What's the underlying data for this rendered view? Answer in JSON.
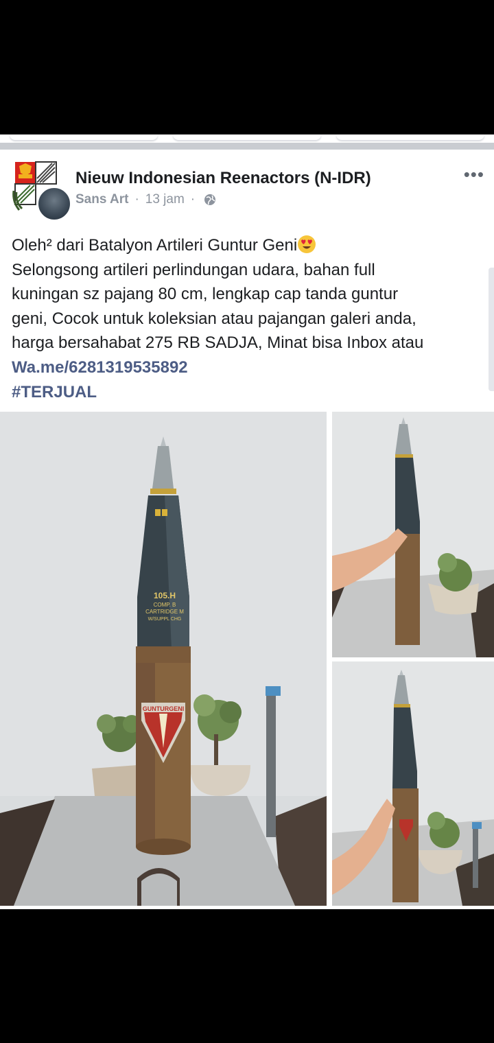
{
  "post": {
    "group_name": "Nieuw Indonesian Reenactors (N-IDR)",
    "author": "Sans Art",
    "time": "13 jam",
    "separator_dot": "·",
    "more_label": "•••",
    "text_lines": [
      "Oleh² dari Batalyon Artileri Guntur Geni",
      "Selongsong artileri perlindungan udara, bahan full",
      "kuningan sz pajang 80 cm, lengkap cap tanda guntur",
      "geni, Cocok untuk koleksian atau pajangan galeri anda,",
      "harga bersahabat 275 RB SADJA, Minat bisa Inbox atau"
    ],
    "link": "Wa.me/6281319535892",
    "hashtag": "#TERJUAL",
    "emoji": "heart-eyes-emoji"
  },
  "photos": {
    "shell_marking_1": "105.H",
    "shell_marking_2": "COMP. B",
    "shell_marking_3": "CARTRIDGE M",
    "shell_marking_4": "W/SUPPL CHG",
    "badge_text": "GUNTURGENI"
  },
  "icons": {
    "globe": "globe-icon",
    "more": "more-options-icon"
  },
  "colors": {
    "link": "#4d5d85",
    "text": "#1c1e21",
    "meta": "#8d949e",
    "separator": "#c9ccd1"
  }
}
